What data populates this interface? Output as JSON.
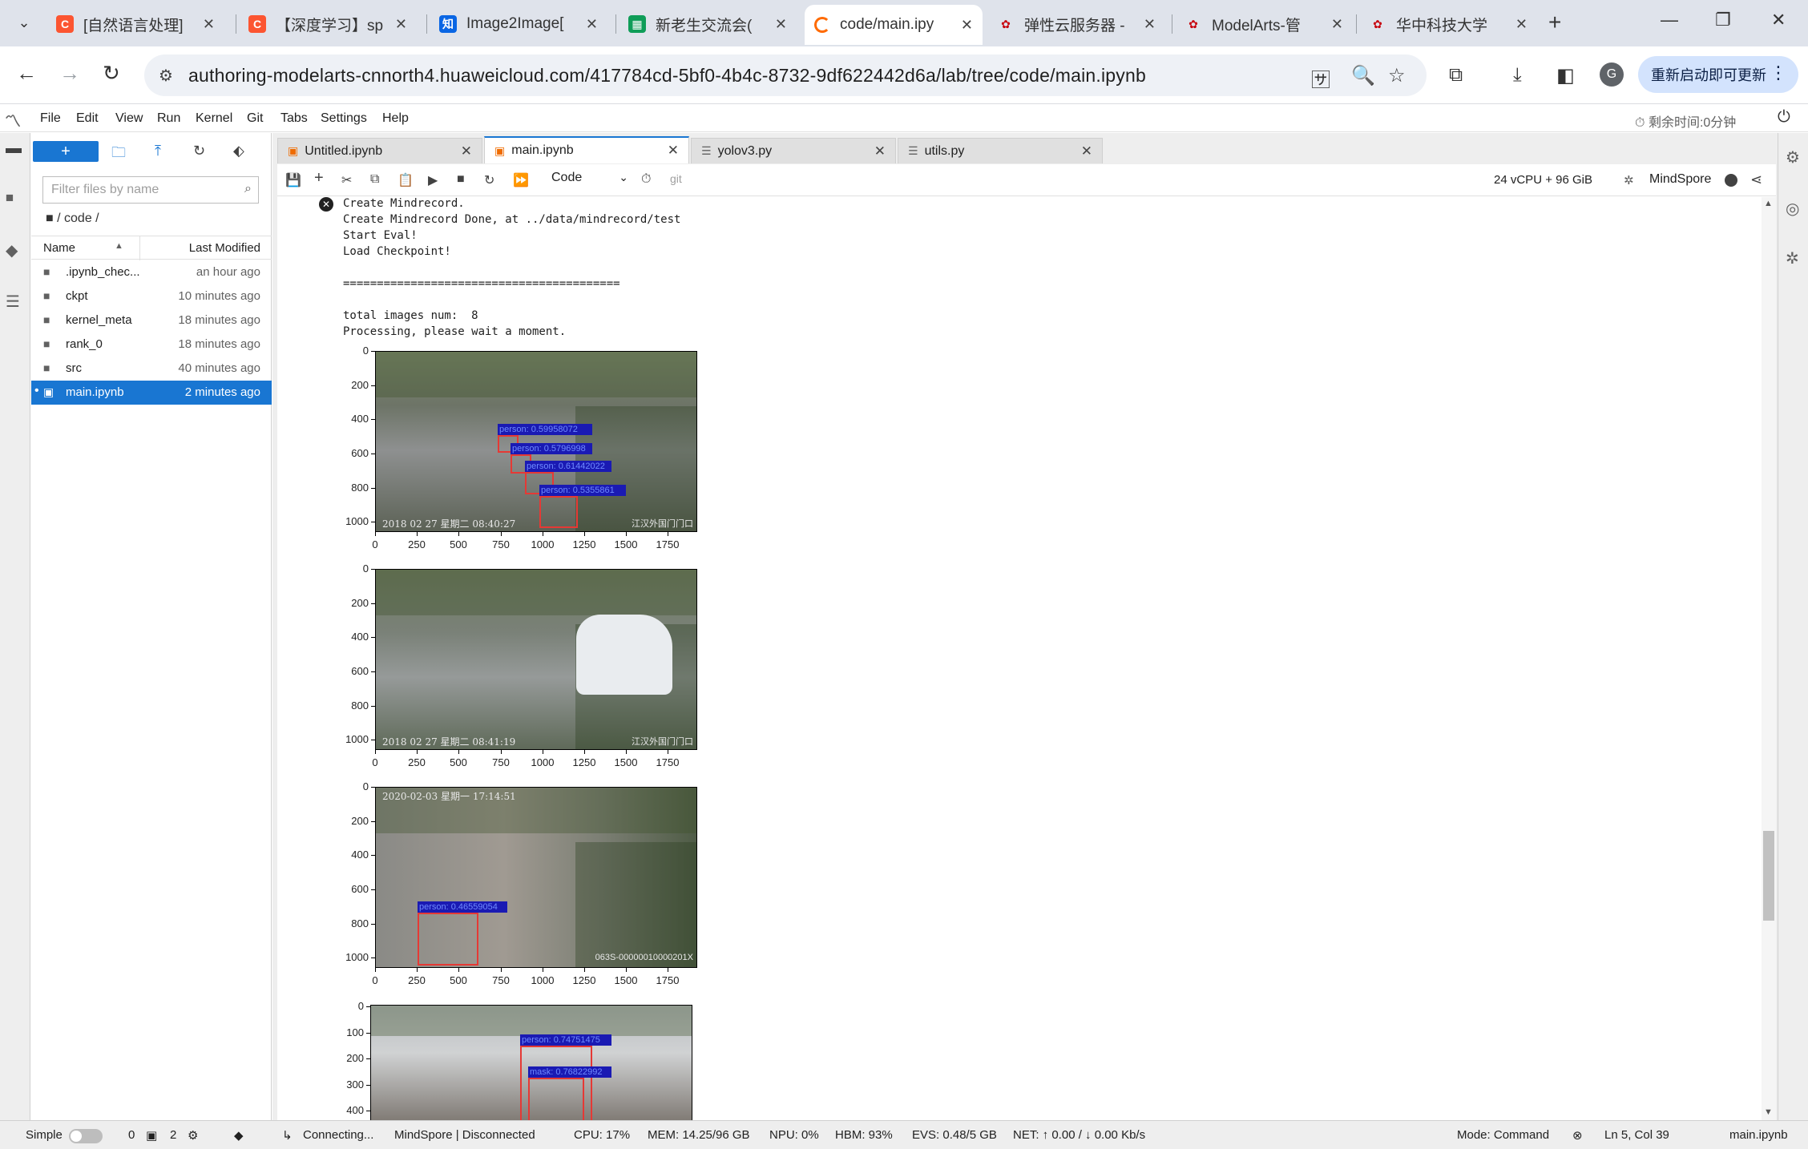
{
  "browser": {
    "tabs": [
      {
        "title": "[自然语言处理]",
        "icon": "csdn-icon",
        "color": "#fc5531",
        "glyph": "C"
      },
      {
        "title": "【深度学习】sp",
        "icon": "csdn-icon",
        "color": "#fc5531",
        "glyph": "C"
      },
      {
        "title": "Image2Image[",
        "icon": "zhihu-icon",
        "color": "#0a66e4",
        "glyph": "知"
      },
      {
        "title": "新老生交流会(",
        "icon": "sheets-icon",
        "color": "#0f9d58",
        "glyph": "▦"
      },
      {
        "title": "code/main.ipy",
        "icon": "modelarts-loading-icon",
        "color": "#ff6a00",
        "glyph": ""
      },
      {
        "title": "弹性云服务器 -",
        "icon": "huawei-icon",
        "color": "#c7000b",
        "glyph": "✿"
      },
      {
        "title": "ModelArts-管",
        "icon": "huawei-icon",
        "color": "#c7000b",
        "glyph": "✿"
      },
      {
        "title": "华中科技大学 ",
        "icon": "huawei-icon",
        "color": "#c7000b",
        "glyph": "✿"
      }
    ],
    "active_tab_index": 4,
    "url": "authoring-modelarts-cnnorth4.huaweicloud.com/417784cd-5bf0-4b4c-8732-9df622442d6a/lab/tree/code/main.ipynb",
    "avatar_letter": "G",
    "update_label": "重新启动即可更新"
  },
  "jupyter": {
    "menu": [
      "File",
      "Edit",
      "View",
      "Run",
      "Kernel",
      "Git",
      "Tabs",
      "Settings",
      "Help"
    ],
    "timer": "剩余时间:0分钟",
    "filebrowser": {
      "filter_placeholder": "Filter files by name",
      "breadcrumb": "/ code /",
      "col_name": "Name",
      "col_modified": "Last Modified",
      "files": [
        {
          "name": ".ipynb_chec...",
          "modified": "an hour ago",
          "type": "folder"
        },
        {
          "name": "ckpt",
          "modified": "10 minutes ago",
          "type": "folder"
        },
        {
          "name": "kernel_meta",
          "modified": "18 minutes ago",
          "type": "folder"
        },
        {
          "name": "rank_0",
          "modified": "18 minutes ago",
          "type": "folder"
        },
        {
          "name": "src",
          "modified": "40 minutes ago",
          "type": "folder"
        },
        {
          "name": "main.ipynb",
          "modified": "2 minutes ago",
          "type": "notebook",
          "selected": true
        }
      ]
    },
    "doc_tabs": [
      {
        "title": "Untitled.ipynb",
        "type": "notebook"
      },
      {
        "title": "main.ipynb",
        "type": "notebook",
        "active": true
      },
      {
        "title": "yolov3.py",
        "type": "python"
      },
      {
        "title": "utils.py",
        "type": "python"
      }
    ],
    "toolbar": {
      "cell_type": "Code",
      "git": "git",
      "resources": "24 vCPU + 96 GiB",
      "kernel": "MindSpore"
    },
    "output_lines": [
      "Create Mindrecord.",
      "Create Mindrecord Done, at ../data/mindrecord/test",
      "Start Eval!",
      "Load Checkpoint!",
      "",
      "=========================================",
      "",
      "total images num:  8",
      "Processing, please wait a moment."
    ],
    "plots": [
      {
        "yticks": [
          "0",
          "200",
          "400",
          "600",
          "800",
          "1000"
        ],
        "xticks": [
          "0",
          "250",
          "500",
          "750",
          "1000",
          "1250",
          "1500",
          "1750"
        ],
        "detections": [
          {
            "label": "person: 0.59958072"
          },
          {
            "label": "person: 0.5796998"
          },
          {
            "label": "person: 0.61442022"
          },
          {
            "label": "person: 0.5355861"
          }
        ],
        "stamp": "2018 02 27 星期二 08:40:27",
        "stamp_right": "江汉外国门门口"
      },
      {
        "yticks": [
          "0",
          "200",
          "400",
          "600",
          "800",
          "1000"
        ],
        "xticks": [
          "0",
          "250",
          "500",
          "750",
          "1000",
          "1250",
          "1500",
          "1750"
        ],
        "detections": [],
        "stamp": "2018 02 27 星期二 08:41:19",
        "stamp_right": "江汉外国门门口"
      },
      {
        "yticks": [
          "0",
          "200",
          "400",
          "600",
          "800",
          "1000"
        ],
        "xticks": [
          "0",
          "250",
          "500",
          "750",
          "1000",
          "1250",
          "1500",
          "1750"
        ],
        "detections": [
          {
            "label": "person: 0.46559054"
          }
        ],
        "stamp": "2020-02-03 星期一 17:14:51",
        "stamp_right": "063S-00000010000201X"
      },
      {
        "yticks": [
          "0",
          "100",
          "200",
          "300",
          "400"
        ],
        "xticks": [],
        "detections": [
          {
            "label": "person: 0.74751475"
          },
          {
            "label": "mask: 0.76822992"
          }
        ],
        "stamp": "",
        "stamp_right": ""
      }
    ],
    "status": {
      "mode_label": "Simple",
      "terminals": "0",
      "kernels": "2",
      "connecting": "Connecting...",
      "kernel_status": "MindSpore | Disconnected",
      "cpu": "CPU: 17%",
      "mem": "MEM: 14.25/96 GB",
      "npu": "NPU: 0%",
      "hbm": "HBM: 93%",
      "evs": "EVS: 0.48/5 GB",
      "net": "NET: ↑ 0.00 / ↓ 0.00 Kb/s",
      "command_mode": "Mode: Command",
      "cursor": "Ln 5, Col 39",
      "file": "main.ipynb"
    }
  },
  "colors": {
    "accent": "#1976d2",
    "detection_box": "#e53935",
    "detection_label_bg": "#1a1ab3"
  }
}
